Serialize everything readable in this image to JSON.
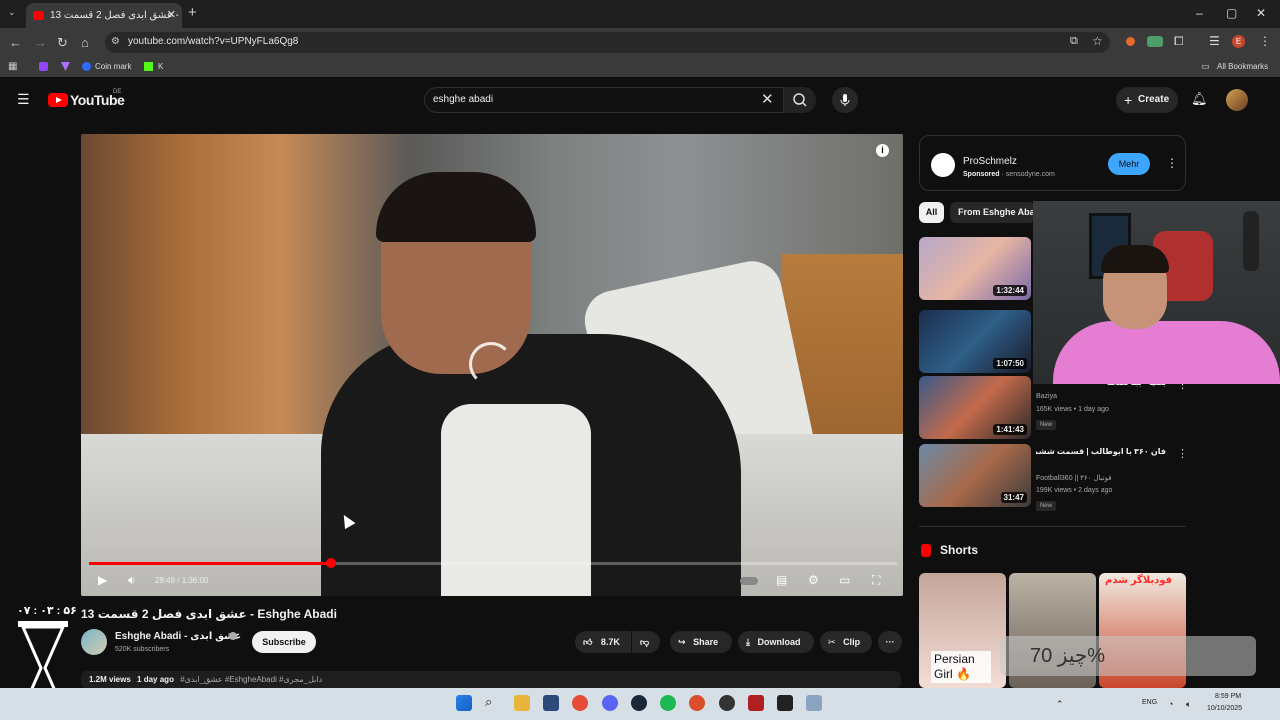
{
  "browser": {
    "tab_title": "عشق ابدی فصل 2 قسمت 13 - e",
    "new_tab": "+",
    "url": "youtube.com/watch?v=UPNyFLa6Qg8",
    "bookmarks": [
      "Coin mark",
      "K"
    ],
    "all_bookmarks": "All Bookmarks",
    "window_controls": [
      "–",
      "▢",
      "✕"
    ]
  },
  "youtube": {
    "logo_text": "YouTube",
    "region": "DE",
    "search_value": "eshghe abadi",
    "create_label": "Create"
  },
  "player": {
    "time": "28:49 / 1:36:00",
    "progress_fraction": 0.3,
    "info": "i"
  },
  "video": {
    "title": "عشق ابدی فصل 2 قسمت 13 - Eshghe Abadi",
    "channel": "Eshghe Abadi - عشق ابدی",
    "subscribers": "520K subscribers",
    "subscribe_label": "Subscribe",
    "likes": "8.7K",
    "share_label": "Share",
    "download_label": "Download",
    "clip_label": "Clip",
    "more": "···",
    "views": "1.2M views",
    "age": "1 day ago",
    "tags": "#عشق_ابدی #EshgheAbadi #دابل_مجری"
  },
  "ad": {
    "name": "ProSchmelz",
    "sponsored": "Sponsored",
    "domain": "sensodyne.com",
    "cta": "Mehr"
  },
  "chips": [
    "All",
    "From Eshghe Aba"
  ],
  "related": [
    {
      "duration": "1:32:44",
      "title": "",
      "channel": "",
      "meta": "",
      "badge": ""
    },
    {
      "duration": "1:07:50",
      "title": "",
      "channel": "",
      "meta": "",
      "badge": ""
    },
    {
      "duration": "1:41:43",
      "title": "بصیا - ببه نصحه",
      "channel": "Baziya",
      "meta": "165K views • 1 day ago",
      "badge": "New"
    },
    {
      "duration": "31:47",
      "title": "فان ۳۶۰ با ابوطالب | قسمت ششم: غوغا به قلب دشمن!",
      "channel": "Football360 || فوتبال ۳۶۰",
      "meta": "199K views • 2 days ago",
      "badge": "New"
    }
  ],
  "shorts": {
    "label": "Shorts",
    "items": [
      {
        "caption": "Persian Girl 🔥"
      },
      {
        "caption": ""
      },
      {
        "caption": "فودبلاگر شدم"
      }
    ]
  },
  "overlays": {
    "clock": "۰۷ : ۰۳ : ۵۶",
    "percent_text": "چیز 70%"
  },
  "taskbar": {
    "lang": "ENG",
    "time": "8:59 PM",
    "date": "10/10/2025"
  }
}
